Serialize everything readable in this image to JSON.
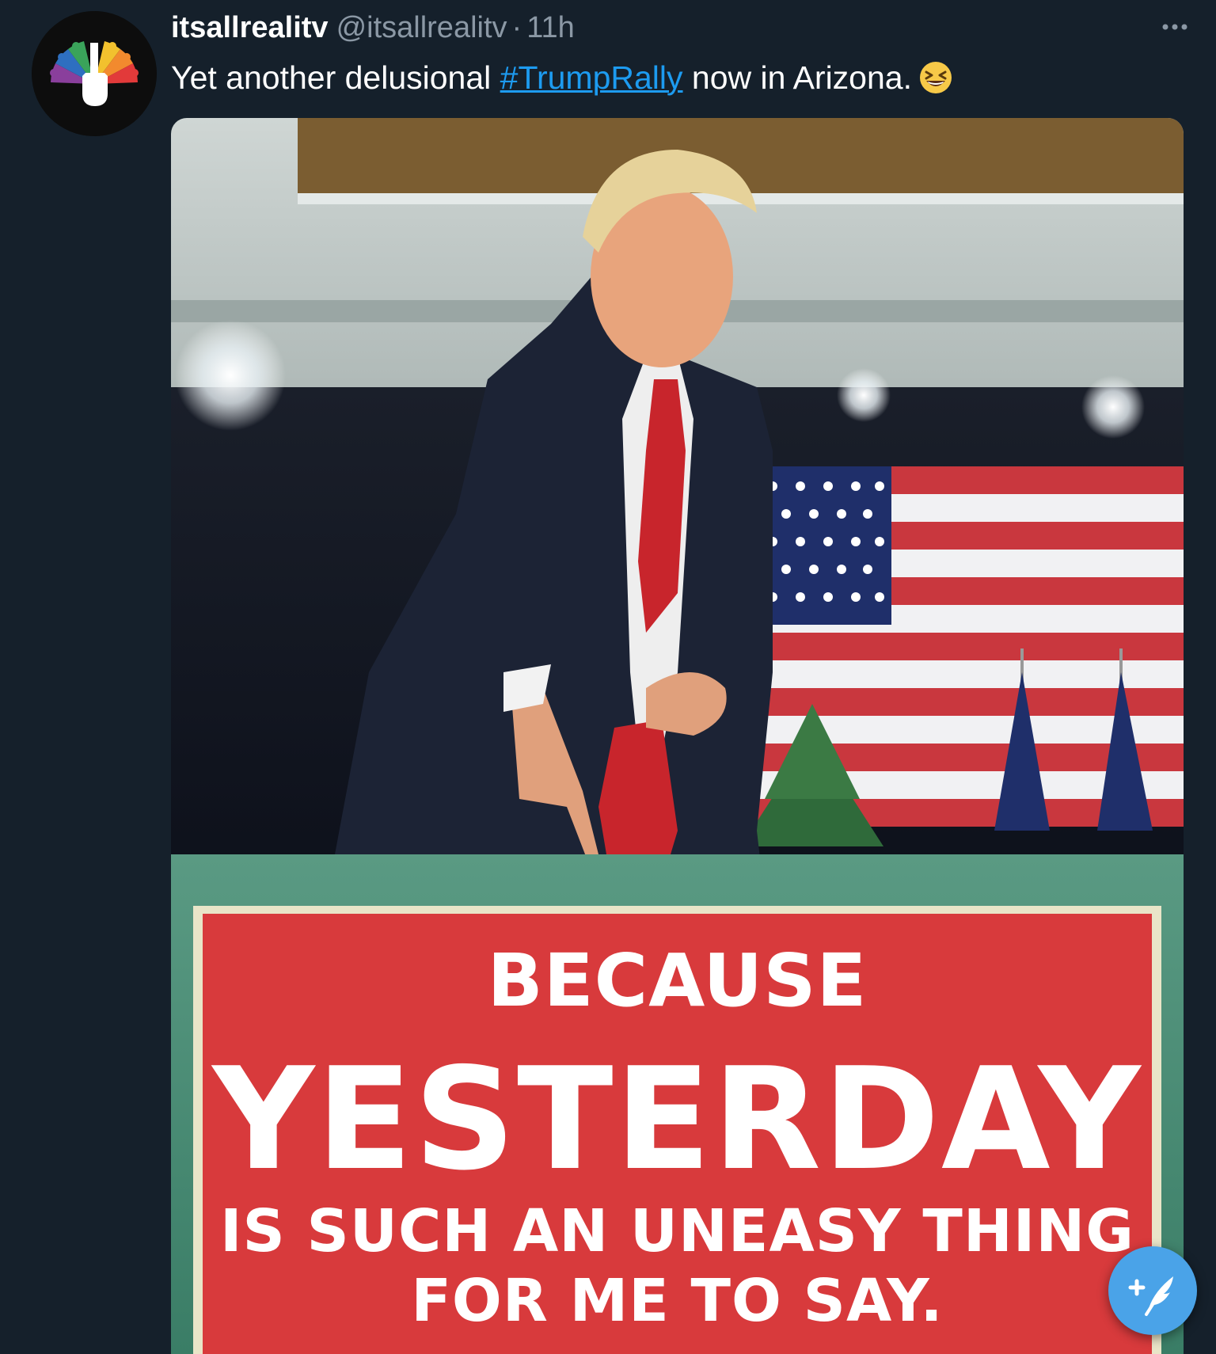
{
  "tweet": {
    "display_name": "itsallrealitv",
    "handle": "@itsallrealitv",
    "separator": "·",
    "time": "11h",
    "text_before": "Yet another delusional ",
    "hashtag": "#TrumpRally",
    "text_after": " now in Arizona.",
    "emoji": "grinning-squinting-face-icon",
    "more_icon": "more-horizontal-icon"
  },
  "media": {
    "sign": {
      "line1": "BECAUSE",
      "line2": "YESTERDAY",
      "line3": "IS SUCH AN UNEASY THING",
      "line4": "FOR ME TO SAY."
    }
  },
  "compose": {
    "icon": "compose-feather-plus-icon"
  },
  "colors": {
    "background": "#15202b",
    "accent": "#1d9bf0",
    "secondary_text": "#8b98a5",
    "fab": "#4aa3e8",
    "sign_red": "#d83a3c",
    "sign_green": "#3f8a6e"
  }
}
